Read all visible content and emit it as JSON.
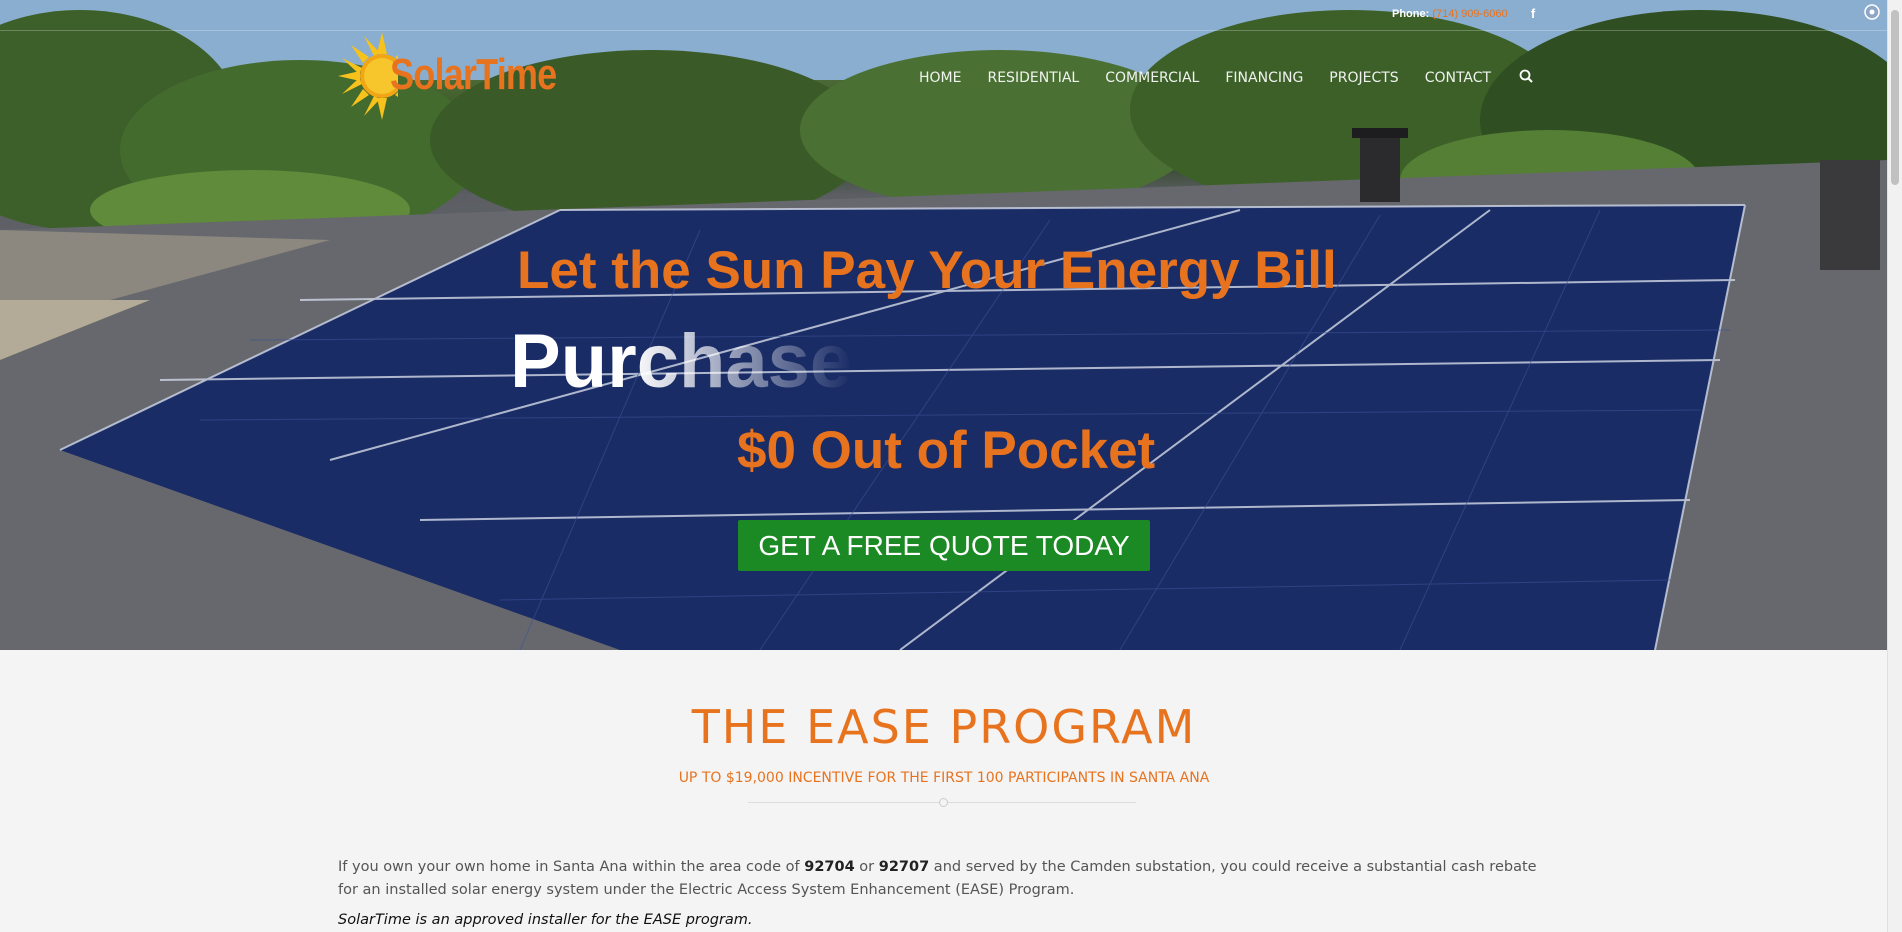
{
  "topbar": {
    "phone_label": "Phone:",
    "phone_number": "(714) 909-6060",
    "facebook_icon": "facebook-icon"
  },
  "logo": {
    "text": "SolarTime"
  },
  "nav": {
    "items": [
      "HOME",
      "RESIDENTIAL",
      "COMMERCIAL",
      "FINANCING",
      "PROJECTS",
      "CONTACT"
    ],
    "search_icon": "search-icon"
  },
  "hero": {
    "headline": "Let the Sun Pay Your Energy Bill",
    "rotating_word": "Purchase",
    "tagline": "$0 Out of Pocket",
    "cta_label": "GET A FREE QUOTE TODAY"
  },
  "section": {
    "title": "THE EASE PROGRAM",
    "subtitle": "UP TO $19,000 INCENTIVE FOR THE FIRST 100 PARTICIPANTS IN SANTA ANA",
    "para_part1": "If you own your own home in Santa Ana within the area code of ",
    "zip1": "92704",
    "para_or": " or ",
    "zip2": "92707",
    "para_part2": " and served by the Camden substation, you could receive a substantial cash rebate for an installed solar energy system under the Electric Access System Enhancement (EASE) Program.",
    "para2": "SolarTime is an approved installer for the EASE program."
  },
  "colors": {
    "accent": "#e8731e",
    "cta": "#1c8a24"
  }
}
